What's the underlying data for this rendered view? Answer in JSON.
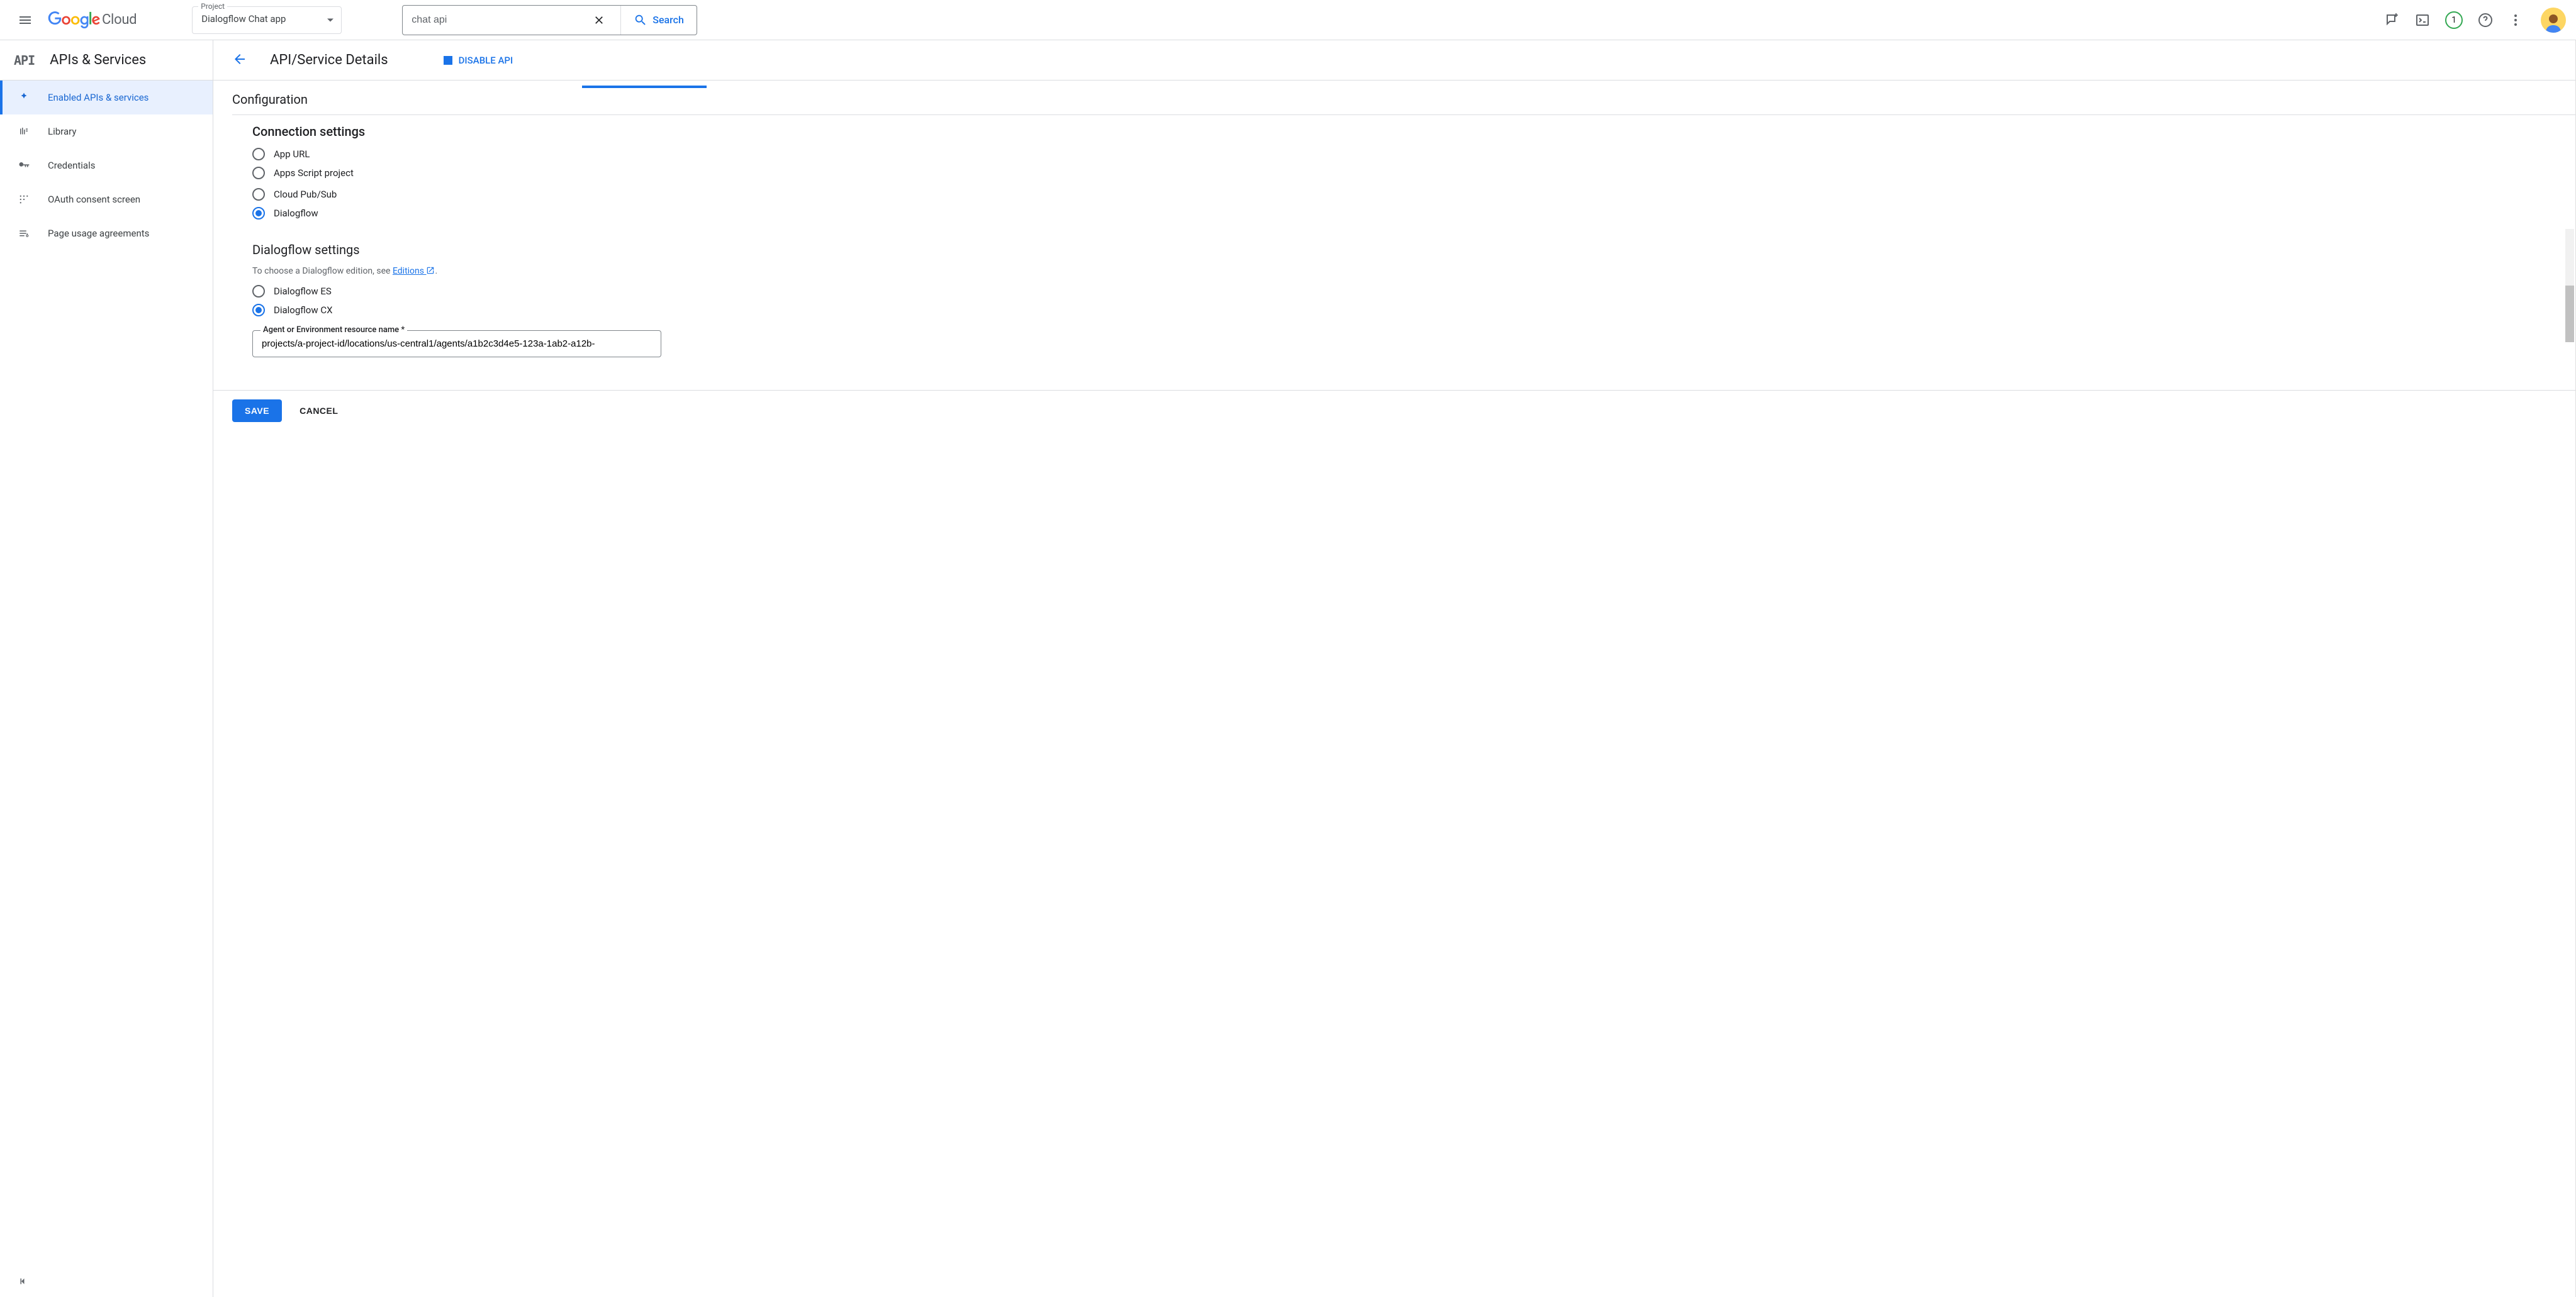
{
  "topbar": {
    "logo_cloud": "Cloud",
    "project_label": "Project",
    "project_value": "Dialogflow Chat app",
    "search_value": "chat api",
    "search_button": "Search",
    "notification_count": "1"
  },
  "sidebar": {
    "badge": "API",
    "title": "APIs & Services",
    "items": [
      {
        "label": "Enabled APIs & services"
      },
      {
        "label": "Library"
      },
      {
        "label": "Credentials"
      },
      {
        "label": "OAuth consent screen"
      },
      {
        "label": "Page usage agreements"
      }
    ]
  },
  "page": {
    "title": "API/Service Details",
    "disable_label": "DISABLE API",
    "config_title": "Configuration",
    "connection_title": "Connection settings",
    "connection_options": [
      "App URL",
      "Apps Script project",
      "Cloud Pub/Sub",
      "Dialogflow"
    ],
    "dialogflow_title": "Dialogflow settings",
    "dialogflow_help_pre": "To choose a Dialogflow edition, see ",
    "dialogflow_help_link": "Editions",
    "dialogflow_help_post": ".",
    "dialogflow_options": [
      "Dialogflow ES",
      "Dialogflow CX"
    ],
    "resource_label": "Agent or Environment resource name *",
    "resource_value": "projects/a-project-id/locations/us-central1/agents/a1b2c3d4e5-123a-1ab2-a12b-",
    "save": "SAVE",
    "cancel": "CANCEL"
  }
}
